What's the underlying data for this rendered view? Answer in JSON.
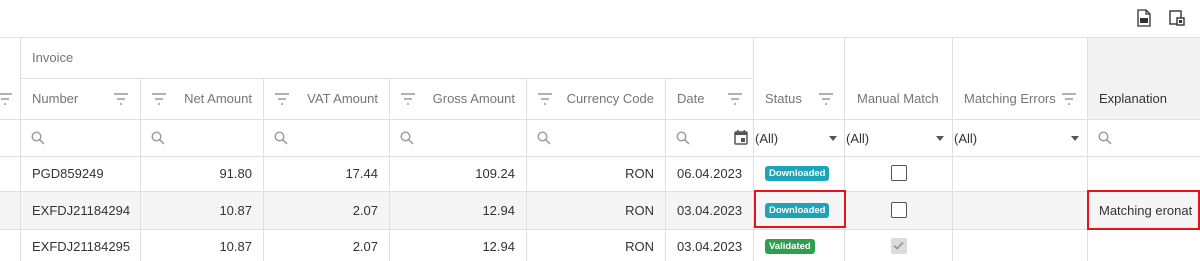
{
  "toolbar": {
    "icons": [
      "export-pdf-icon",
      "column-chooser-icon"
    ]
  },
  "header": {
    "band_label": "Invoice",
    "columns": {
      "number": "Number",
      "net_amount": "Net Amount",
      "vat_amount": "VAT Amount",
      "gross_amount": "Gross Amount",
      "currency_code": "Currency Code",
      "date": "Date",
      "status": "Status",
      "manual_match": "Manual Match",
      "matching_errors": "Matching Errors",
      "explanation": "Explanation"
    }
  },
  "filters": {
    "status": "(All)",
    "manual_match": "(All)",
    "matching_errors": "(All)"
  },
  "rows": [
    {
      "number": "PGD859249",
      "net": "91.80",
      "vat": "17.44",
      "gross": "109.24",
      "currency": "RON",
      "date": "06.04.2023",
      "status": "Downloaded",
      "manual_checked": false,
      "explanation": ""
    },
    {
      "number": "EXFDJ21184294",
      "net": "10.87",
      "vat": "2.07",
      "gross": "12.94",
      "currency": "RON",
      "date": "03.04.2023",
      "status": "Downloaded",
      "manual_checked": false,
      "explanation": "Matching eronat"
    },
    {
      "number": "EXFDJ21184295",
      "net": "10.87",
      "vat": "2.07",
      "gross": "12.94",
      "currency": "RON",
      "date": "03.04.2023",
      "status": "Validated",
      "manual_checked": true,
      "explanation": ""
    }
  ],
  "colors": {
    "downloaded_badge": "#1ea4b8",
    "validated_badge": "#2e9e4f",
    "highlight_border": "#e5131e",
    "selected_row": "#f5f5f5",
    "explanation_header": "#f2f2f2"
  }
}
